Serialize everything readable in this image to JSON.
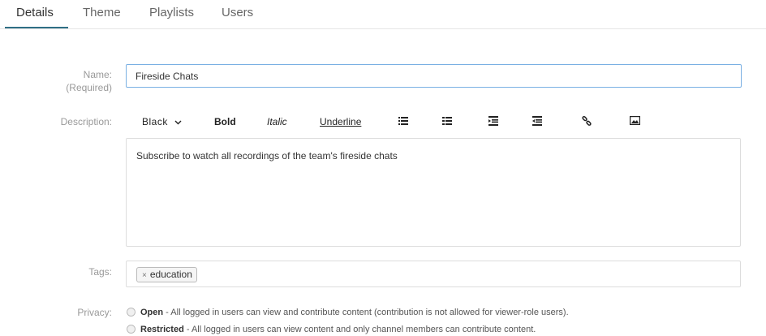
{
  "tabs": [
    {
      "label": "Details",
      "active": true
    },
    {
      "label": "Theme"
    },
    {
      "label": "Playlists"
    },
    {
      "label": "Users"
    }
  ],
  "form": {
    "name_label": "Name:",
    "name_required": "(Required)",
    "name_value": "Fireside Chats",
    "description_label": "Description:",
    "description_value": "Subscribe to watch all recordings of the team's fireside chats",
    "tags_label": "Tags:",
    "tags": [
      {
        "label": "education",
        "remove": "×"
      }
    ],
    "privacy_label": "Privacy:",
    "privacy_options": [
      {
        "title": "Open",
        "text": " - All logged in users can view and contribute content (contribution is not allowed for viewer-role users)."
      },
      {
        "title": "Restricted",
        "text": " - All logged in users can view content and only channel members can contribute content."
      }
    ]
  },
  "toolbar": {
    "color_label": "Black",
    "color_chevron": "⌄",
    "bold_label": "Bold",
    "italic_label": "Italic",
    "underline_label": "Underline",
    "icons": [
      "bulleted-list-icon",
      "numbered-list-icon",
      "indent-icon",
      "outdent-icon",
      "link-icon",
      "image-icon"
    ]
  },
  "colors": {
    "accent": "#2f6f85",
    "focus_border": "#7ab0e3"
  }
}
